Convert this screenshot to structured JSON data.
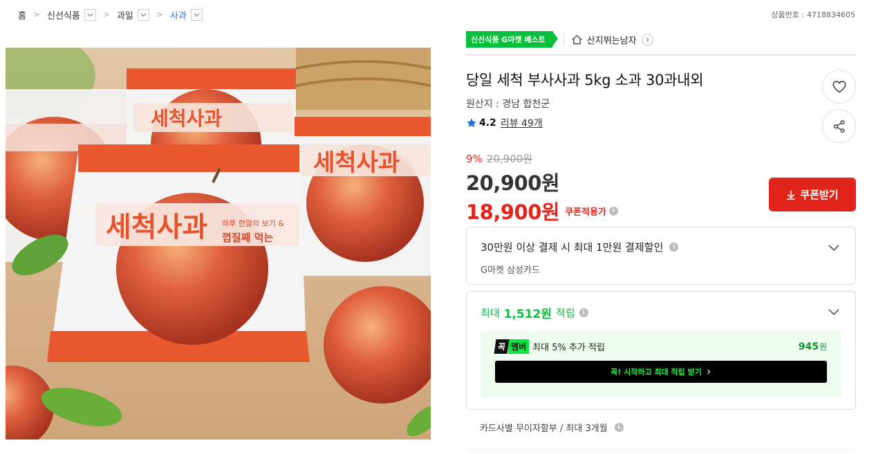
{
  "breadcrumb": [
    {
      "label": "홈",
      "dropdown": false
    },
    {
      "label": "신선식품",
      "dropdown": true
    },
    {
      "label": "과일",
      "dropdown": true
    },
    {
      "label": "사과",
      "dropdown": true,
      "active": true
    }
  ],
  "product_no": {
    "label": "상품번호 :",
    "value": "4718834605"
  },
  "hero": {
    "package_brand": "세척사과",
    "package_tagline": "하루 한알의 보기 & 껍질째 먹는",
    "package_tagline2": "껍질째 먹는"
  },
  "badge": {
    "label": "신선식품 G마켓 베스트",
    "color": "#0abf3a"
  },
  "store": {
    "name": "산지뛰는남자"
  },
  "title": "당일 세척 부사사과 5kg 소과 30과내외",
  "origin": "원산지 : 경남 합천군",
  "rating": {
    "score": "4.2",
    "reviews": "리뷰 49개"
  },
  "price": {
    "discount": "9%",
    "original": "20,900원",
    "sale": "20,900원",
    "coupon_price": "18,900원",
    "coupon_label": "쿠폰적용가",
    "accent": "#e1251b"
  },
  "coupon_button": "쿠폰받기",
  "card_discount": {
    "headline": "30만원 이상 결제 시 최대 1만원 결제할인",
    "sub": "G마켓 삼성카드"
  },
  "points": {
    "prefix": "최대",
    "amount": "1,512원",
    "suffix": "적립",
    "member_logo_1": "꼭",
    "member_logo_2": "멤버",
    "member_text": "최대 5% 추가 적립",
    "member_amount": "945",
    "member_unit": "원",
    "cta": "꼭! 시작하고 최대 적립 받기"
  },
  "installment": "카드사별 무이자할부 / 최대 3개월"
}
